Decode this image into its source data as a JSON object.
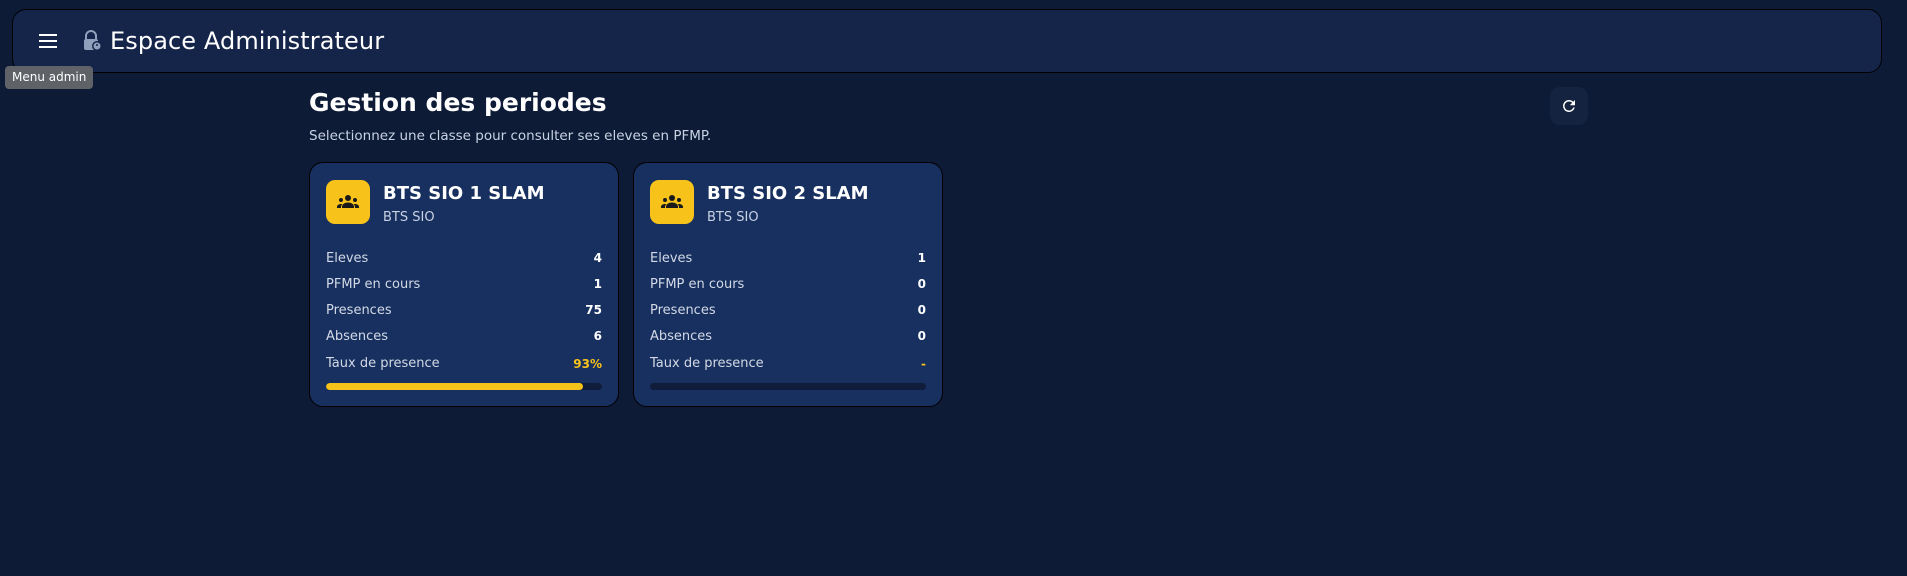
{
  "header": {
    "title": "Espace Administrateur",
    "menu_tooltip": "Menu admin"
  },
  "page": {
    "title": "Gestion des periodes",
    "subtitle": "Selectionnez une classe pour consulter ses eleves en PFMP."
  },
  "colors": {
    "accent": "#f7c21a",
    "background": "#0d1b36",
    "card": "#17305f"
  },
  "cards": [
    {
      "title": "BTS SIO 1 SLAM",
      "subtitle": "BTS SIO",
      "stats": [
        {
          "label": "Eleves",
          "value": "4"
        },
        {
          "label": "PFMP en cours",
          "value": "1"
        },
        {
          "label": "Presences",
          "value": "75"
        },
        {
          "label": "Absences",
          "value": "6"
        }
      ],
      "rate_label": "Taux de presence",
      "rate_value": "93%",
      "rate_fraction": 0.93
    },
    {
      "title": "BTS SIO 2 SLAM",
      "subtitle": "BTS SIO",
      "stats": [
        {
          "label": "Eleves",
          "value": "1"
        },
        {
          "label": "PFMP en cours",
          "value": "0"
        },
        {
          "label": "Presences",
          "value": "0"
        },
        {
          "label": "Absences",
          "value": "0"
        }
      ],
      "rate_label": "Taux de presence",
      "rate_value": "-",
      "rate_fraction": 0
    }
  ]
}
